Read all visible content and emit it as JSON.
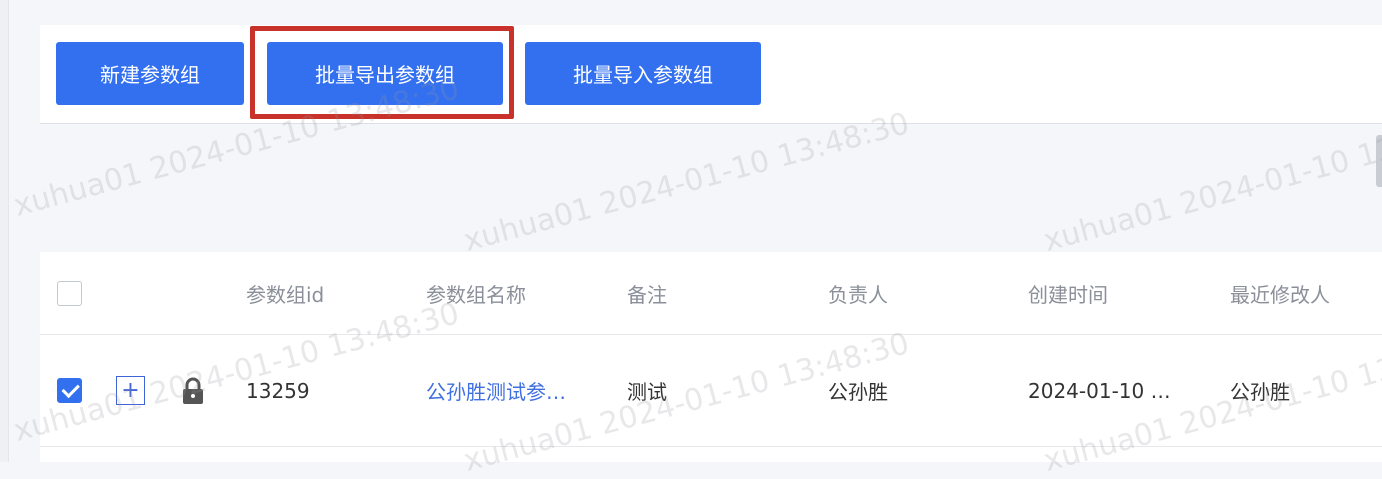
{
  "toolbar": {
    "new_group_label": "新建参数组",
    "export_label": "批量导出参数组",
    "import_label": "批量导入参数组"
  },
  "table": {
    "columns": [
      "参数组id",
      "参数组名称",
      "备注",
      "负责人",
      "创建时间",
      "最近修改人"
    ],
    "rows": [
      {
        "checked": true,
        "id": "13259",
        "name": "公孙胜测试参…",
        "remark": "测试",
        "owner": "公孙胜",
        "created": "2024-01-10 …",
        "modifier": "公孙胜"
      }
    ]
  },
  "icons": {
    "expand": "plus-icon",
    "lock": "lock-icon"
  },
  "colors": {
    "primary": "#3370f0",
    "highlight": "#c8322a",
    "link": "#3f6fe0"
  },
  "watermark": {
    "text": "xuhua01 2024-01-10 13:48:30"
  }
}
